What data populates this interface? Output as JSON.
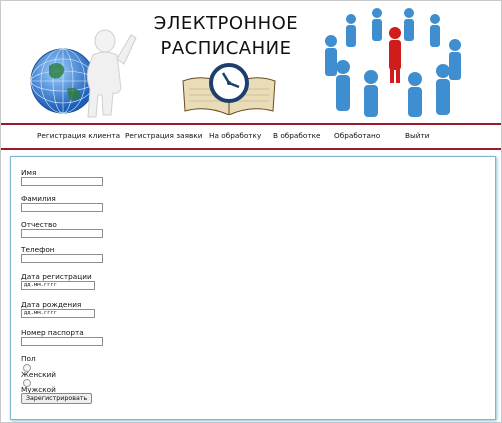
{
  "header": {
    "title_line1": "ЭЛЕКТРОННОЕ",
    "title_line2": "РАСПИСАНИЕ"
  },
  "nav": {
    "items": [
      {
        "label": "Регистрация клиента"
      },
      {
        "label": "Регистрация заявки"
      },
      {
        "label": "На обработку"
      },
      {
        "label": "В обработке"
      },
      {
        "label": "Обработано"
      },
      {
        "label": "Выйти"
      }
    ]
  },
  "form": {
    "name_label": "Имя",
    "surname_label": "Фамилия",
    "patronymic_label": "Отчество",
    "phone_label": "Телефон",
    "reg_date_label": "Дата регистрации",
    "reg_date_placeholder": "дд.мм.гггг",
    "birth_date_label": "Дата рождения",
    "birth_date_placeholder": "дд.мм.гггг",
    "passport_label": "Номер паспорта",
    "gender_label": "Пол",
    "female_label": "Женский",
    "male_label": "Мужской",
    "submit_label": "Зарегистрировать"
  },
  "colors": {
    "accent_line": "#9b1b2a",
    "panel_border": "#7fb8cc"
  }
}
